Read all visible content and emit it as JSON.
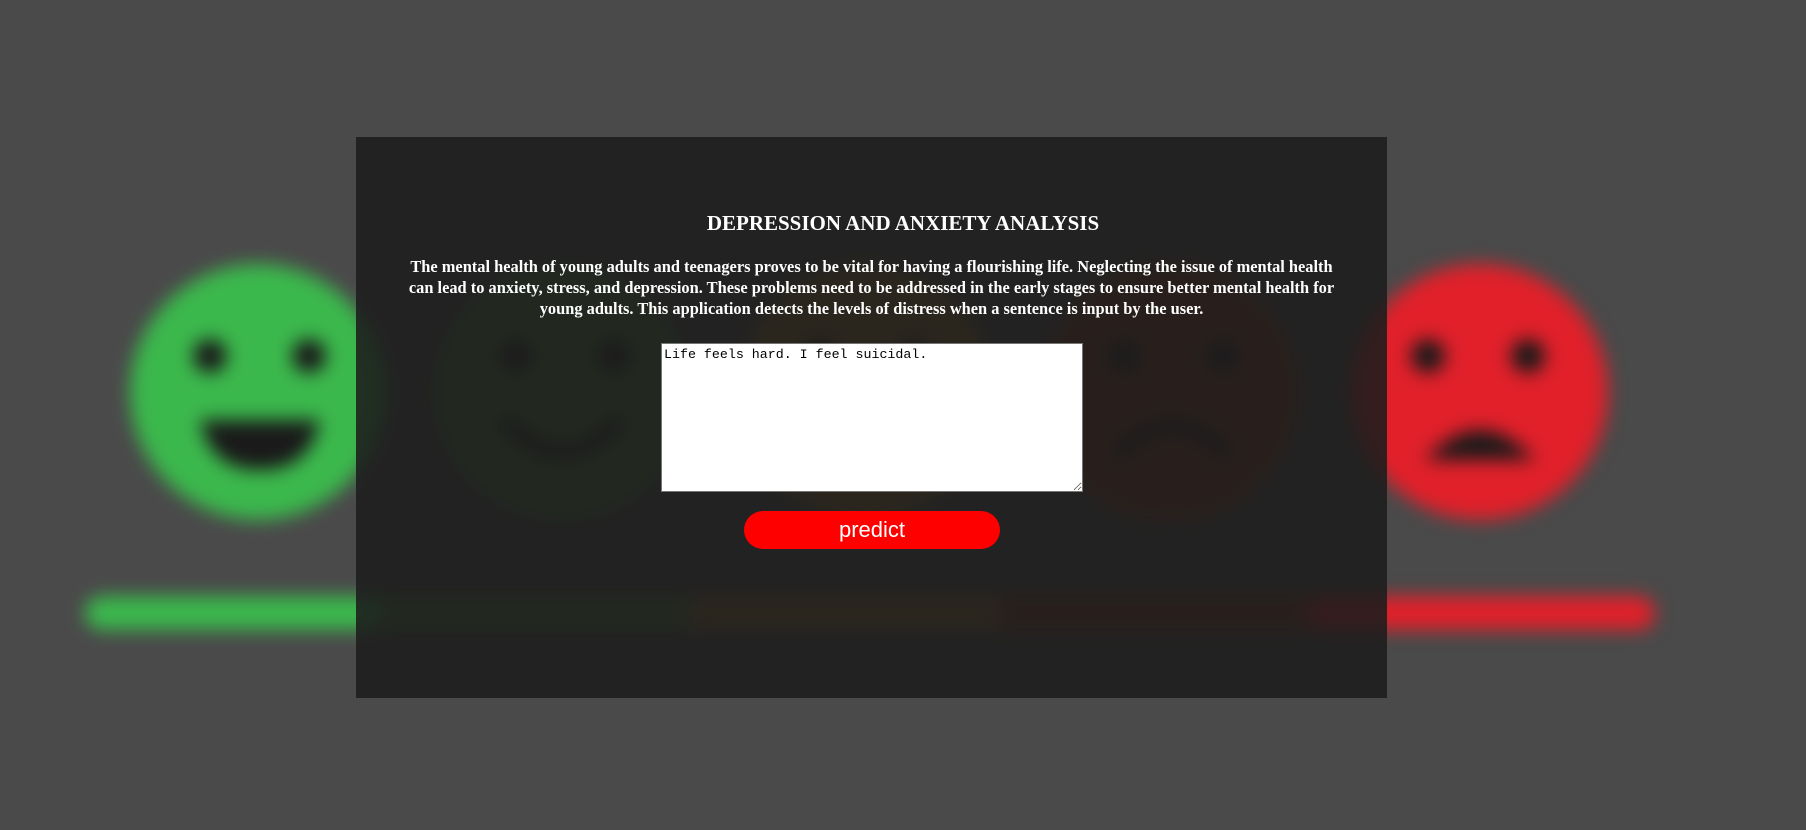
{
  "page": {
    "title": "DEPRESSION AND ANXIETY ANALYSIS",
    "description": "The mental health of young adults and teenagers proves to be vital for having a flourishing life. Neglecting the issue of mental health can lead to anxiety, stress, and depression. These problems need to be addressed in the early stages to ensure better mental health for young adults. This application detects the levels of distress when a sentence is input by the user."
  },
  "input": {
    "value": "Life feels hard. I feel suicidal."
  },
  "predict_button": {
    "label": "predict",
    "color": "#ff0000"
  },
  "background": {
    "face_colors": [
      "#3bb84c",
      "#4e7a3b",
      "#8f6a2c",
      "#7d3418",
      "#e1202a"
    ],
    "face_icons": [
      "laughing-face-icon",
      "smiling-face-icon",
      "neutral-face-icon",
      "frowning-face-icon",
      "distressed-face-icon"
    ]
  }
}
